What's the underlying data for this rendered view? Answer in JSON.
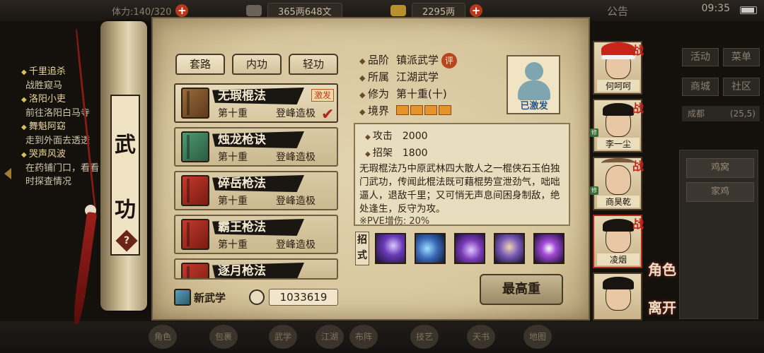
{
  "hud": {
    "stamina": "体力:140/320",
    "silver": "365两648文",
    "gold": "2295两",
    "announce": "公告",
    "time": "09:35"
  },
  "quests": [
    {
      "title": "千里追杀",
      "desc": "战胜窥马"
    },
    {
      "title": "洛阳小吏",
      "desc": "前往洛阳白马寺"
    },
    {
      "title": "舞魁阿窈",
      "desc": "走到外面去透透"
    },
    {
      "title": "哭声风波",
      "desc": "在药铺门口，看看",
      "desc2": "时探查情况"
    }
  ],
  "background_right": {
    "buttons": [
      "活动",
      "菜单",
      "商城",
      "社区"
    ],
    "location": "成都",
    "coords": "(25,5)",
    "list": [
      "鸡窝",
      "家鸡"
    ]
  },
  "scroll": {
    "char1": "武",
    "char2": "功",
    "help": "?"
  },
  "tabs": [
    "套路",
    "内功",
    "轻功"
  ],
  "skills": [
    {
      "name": "无瑕棍法",
      "level": "第十重",
      "rank": "登峰造极",
      "badge": "激发",
      "book": "brown",
      "selected": true
    },
    {
      "name": "烛龙枪诀",
      "level": "第十重",
      "rank": "登峰造极",
      "book": "green"
    },
    {
      "name": "碎岳枪法",
      "level": "第十重",
      "rank": "登峰造极",
      "book": "red"
    },
    {
      "name": "霸王枪法",
      "level": "第十重",
      "rank": "登峰造极",
      "book": "red"
    },
    {
      "name": "逐月枪法",
      "book": "red"
    }
  ],
  "footer": {
    "new_skill": "新武学",
    "points": "1033619"
  },
  "detail": {
    "grade_label": "品阶",
    "grade": "镇派武学",
    "eval": "评",
    "belong_label": "所属",
    "belong": "江湖武学",
    "cultivation_label": "修为",
    "cultivation": "第十重(十)",
    "realm_label": "境界",
    "realm_segments": 4,
    "portrait_caption": "已激发",
    "attack_label": "攻击",
    "attack": "2000",
    "parry_label": "招架",
    "parry": "1800",
    "description": "无瑕棍法乃中原武林四大散人之一棍侠石玉伯独门武功，传闻此棍法既可藉棍势宣泄劲气，咄咄逼人，退敌千里；又可悄无声息间困身制敌，绝处逢生，反守为攻。",
    "pve": "※PVE增伤: 20%",
    "moves_label": "招式",
    "max_button": "最高重"
  },
  "roster": [
    {
      "name": "何呵呵",
      "battle": "战",
      "style": "hat"
    },
    {
      "name": "李一尘",
      "battle": "战",
      "style": "hair"
    },
    {
      "name": "商昊乾",
      "battle": "战",
      "style": "horns"
    },
    {
      "name": "凌烟",
      "battle": "战",
      "style": "hair",
      "selected": true
    },
    {
      "name": "",
      "style": "hair"
    }
  ],
  "roster_xiu": "修",
  "side_labels": {
    "role": "角色",
    "leave": "离开"
  },
  "bottom_menu": [
    "角色",
    "包裹",
    "武学",
    "江湖",
    "布阵",
    "技艺",
    "天书",
    "地图"
  ]
}
